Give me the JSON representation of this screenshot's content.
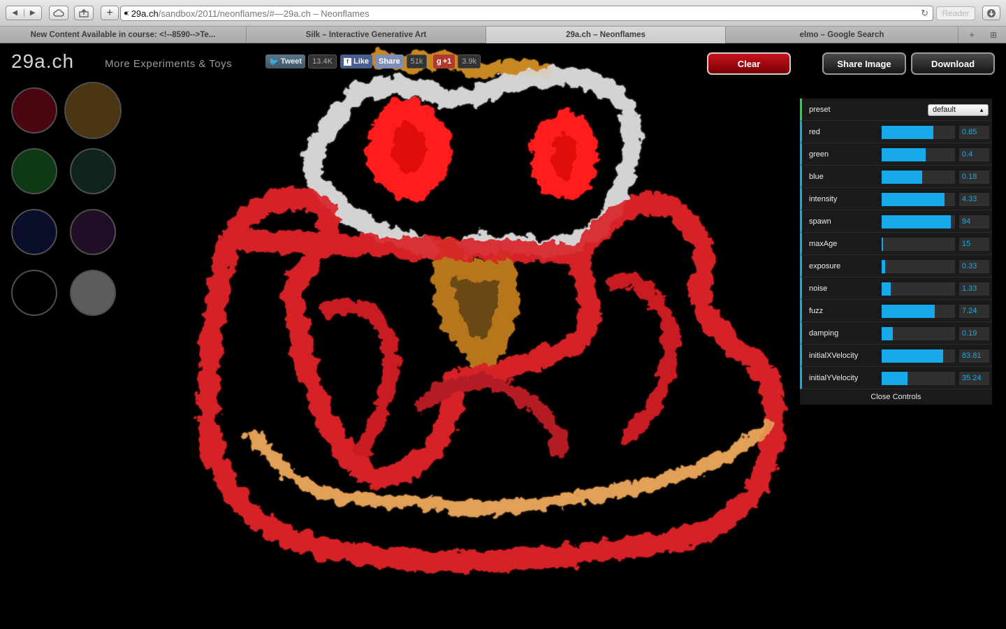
{
  "browser": {
    "back_label": "◀",
    "forward_label": "▶",
    "url_host": "29a.ch",
    "url_path": "/sandbox/2011/neonflames/#",
    "url_sep": " — ",
    "url_title": "29a.ch – Neonflames",
    "reader_label": "Reader",
    "tabs": [
      {
        "label": "New Content Available in course: <!--8590-->Te..."
      },
      {
        "label": "Silk – Interactive Generative Art"
      },
      {
        "label": "29a.ch – Neonflames"
      },
      {
        "label": "elmo – Google Search"
      }
    ]
  },
  "page": {
    "logo": "29a.ch",
    "more_link": "More Experiments & Toys",
    "social": {
      "tweet": "Tweet",
      "tweet_count": "13.4K",
      "like": "Like",
      "share": "Share",
      "like_count": "51k",
      "gplus": "+1",
      "gplus_count": "3.9k"
    },
    "buttons": {
      "clear": "Clear",
      "share_image": "Share Image",
      "download": "Download"
    },
    "swatches": [
      "#4a0510",
      "#4b3512",
      "#0b3a14",
      "#0e241c",
      "#0b0e2a",
      "#1f0e26",
      "#000000",
      "#5c5c5c"
    ]
  },
  "controls": {
    "preset_label": "preset",
    "preset_value": "default",
    "params": [
      {
        "label": "red",
        "value": "0.85",
        "fraction": 0.7
      },
      {
        "label": "green",
        "value": "0.4",
        "fraction": 0.6
      },
      {
        "label": "blue",
        "value": "0.18",
        "fraction": 0.55
      },
      {
        "label": "intensity",
        "value": "4.33",
        "fraction": 0.86
      },
      {
        "label": "spawn",
        "value": "94",
        "fraction": 0.94
      },
      {
        "label": "maxAge",
        "value": "15",
        "fraction": 0.02
      },
      {
        "label": "exposure",
        "value": "0.33",
        "fraction": 0.05
      },
      {
        "label": "noise",
        "value": "1.33",
        "fraction": 0.12
      },
      {
        "label": "fuzz",
        "value": "7.24",
        "fraction": 0.72
      },
      {
        "label": "damping",
        "value": "0.19",
        "fraction": 0.15
      },
      {
        "label": "initialXVelocity",
        "value": "83.81",
        "fraction": 0.84
      },
      {
        "label": "initialYVelocity",
        "value": "35.24",
        "fraction": 0.35
      }
    ],
    "close_label": "Close Controls"
  }
}
